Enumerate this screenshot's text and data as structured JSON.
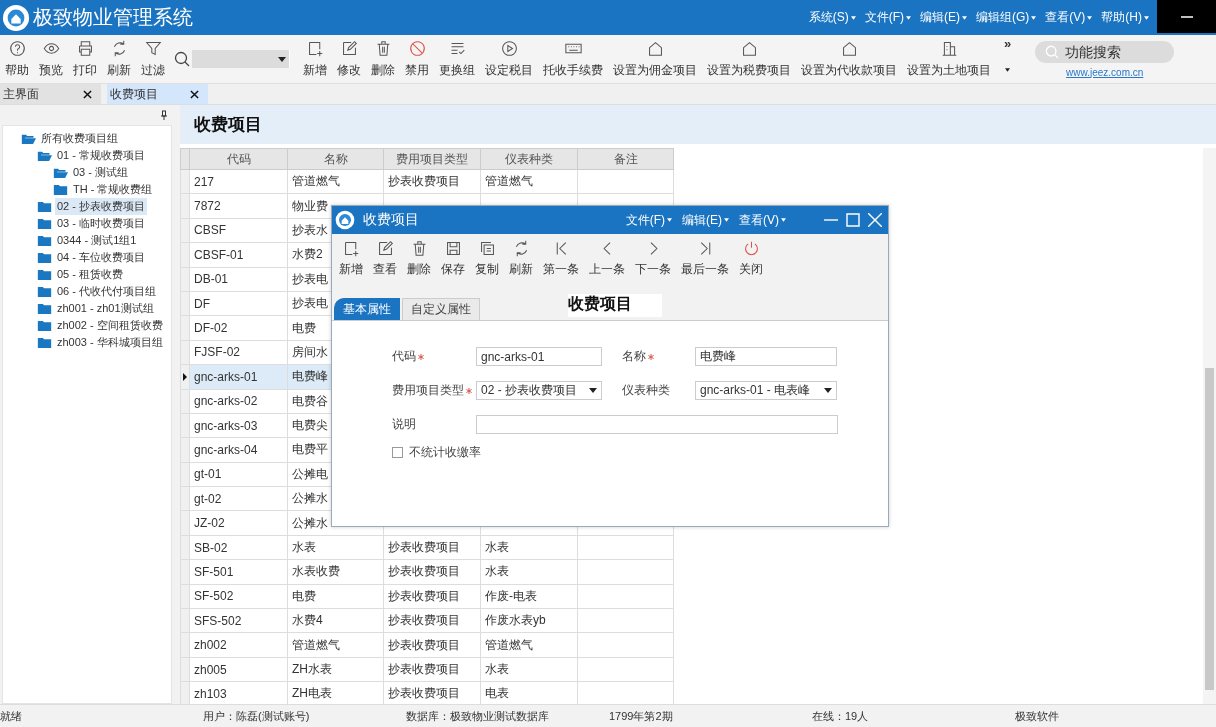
{
  "window": {
    "title": "极致物业管理系统",
    "menus": [
      {
        "label": "系统(S)"
      },
      {
        "label": "文件(F)"
      },
      {
        "label": "编辑(E)"
      },
      {
        "label": "编辑组(G)"
      },
      {
        "label": "查看(V)"
      },
      {
        "label": "帮助(H)"
      }
    ]
  },
  "toolbar": {
    "left": [
      {
        "label": "帮助"
      },
      {
        "label": "预览"
      },
      {
        "label": "打印"
      },
      {
        "label": "刷新"
      },
      {
        "label": "过滤"
      }
    ],
    "right": [
      {
        "label": "新增"
      },
      {
        "label": "修改"
      },
      {
        "label": "删除"
      },
      {
        "label": "禁用"
      },
      {
        "label": "更换组"
      },
      {
        "label": "设定税目"
      },
      {
        "label": "托收手续费"
      },
      {
        "label": "设置为佣金项目"
      },
      {
        "label": "设置为税费项目"
      },
      {
        "label": "设置为代收款项目"
      },
      {
        "label": "设置为土地项目"
      }
    ],
    "more": "»",
    "feature_search": {
      "placeholder": "功能搜索"
    },
    "link": "www.jeez.com.cn"
  },
  "tabs": [
    {
      "label": "主界面",
      "selected": false
    },
    {
      "label": "收费项目",
      "selected": true
    }
  ],
  "tree": [
    {
      "label": "所有收费项目组",
      "expanded": true,
      "selected": false,
      "children": [
        {
          "label": "01 - 常规收费项目",
          "expanded": true,
          "selected": false,
          "children": [
            {
              "label": "03 - 测试组",
              "expanded": true,
              "selected": false
            },
            {
              "label": "TH - 常规收费组",
              "expanded": false,
              "selected": false
            }
          ]
        },
        {
          "label": "02 - 抄表收费项目",
          "expanded": false,
          "selected": true
        },
        {
          "label": "03 - 临时收费项目",
          "expanded": false,
          "selected": false
        },
        {
          "label": "0344 - 测试1组1",
          "expanded": false,
          "selected": false
        },
        {
          "label": "04 - 车位收费项目",
          "expanded": false,
          "selected": false
        },
        {
          "label": "05 - 租赁收费",
          "expanded": false,
          "selected": false
        },
        {
          "label": "06 - 代收代付项目组",
          "expanded": false,
          "selected": false
        },
        {
          "label": "zh001 - zh01测试组",
          "expanded": false,
          "selected": false
        },
        {
          "label": "zh002 - 空间租赁收费",
          "expanded": false,
          "selected": false
        },
        {
          "label": "zh003 - 华科城项目组",
          "expanded": false,
          "selected": false
        }
      ]
    }
  ],
  "content": {
    "heading": "收费项目",
    "table": {
      "columns": [
        "代码",
        "名称",
        "费用项目类型",
        "仪表种类",
        "备注"
      ],
      "rows": [
        {
          "code": "217",
          "name": "管道燃气",
          "type": "抄表收费项目",
          "meter": "管道燃气",
          "selected": false
        },
        {
          "code": "7872",
          "name": "物业费",
          "selected": false
        },
        {
          "code": "CBSF",
          "name": "抄表水",
          "selected": false
        },
        {
          "code": "CBSF-01",
          "name": "水费2",
          "selected": false
        },
        {
          "code": "DB-01",
          "name": "抄表电",
          "selected": false
        },
        {
          "code": "DF",
          "name": "抄表电",
          "selected": false
        },
        {
          "code": "DF-02",
          "name": "电费",
          "selected": false
        },
        {
          "code": "FJSF-02",
          "name": "房间水",
          "selected": false
        },
        {
          "code": "gnc-arks-01",
          "name": "电费峰",
          "selected": true
        },
        {
          "code": "gnc-arks-02",
          "name": "电费谷",
          "selected": false
        },
        {
          "code": "gnc-arks-03",
          "name": "电费尖",
          "selected": false
        },
        {
          "code": "gnc-arks-04",
          "name": "电费平",
          "selected": false
        },
        {
          "code": "gt-01",
          "name": "公摊电",
          "selected": false
        },
        {
          "code": "gt-02",
          "name": "公摊水",
          "selected": false
        },
        {
          "code": "JZ-02",
          "name": "公摊水",
          "selected": false
        },
        {
          "code": "SB-02",
          "name": "水表",
          "type": "抄表收费项目",
          "meter": "水表",
          "selected": false
        },
        {
          "code": "SF-501",
          "name": "水表收费",
          "type": "抄表收费项目",
          "meter": "水表",
          "selected": false
        },
        {
          "code": "SF-502",
          "name": "电费",
          "type": "抄表收费项目",
          "meter": "作废-电表",
          "selected": false
        },
        {
          "code": "SFS-502",
          "name": "水费4",
          "type": "抄表收费项目",
          "meter": "作废水表yb",
          "selected": false
        },
        {
          "code": "zh002",
          "name": "管道燃气",
          "type": "抄表收费项目",
          "meter": "管道燃气",
          "selected": false
        },
        {
          "code": "zh005",
          "name": "ZH水表",
          "type": "抄表收费项目",
          "meter": "水表",
          "selected": false
        },
        {
          "code": "zh103",
          "name": "ZH电表",
          "type": "抄表收费项目",
          "meter": "电表",
          "selected": false
        }
      ]
    }
  },
  "dialog": {
    "title": "收费项目",
    "menus": [
      {
        "label": "文件(F)"
      },
      {
        "label": "编辑(E)"
      },
      {
        "label": "查看(V)"
      }
    ],
    "toolbar": [
      {
        "label": "新增"
      },
      {
        "label": "查看"
      },
      {
        "label": "删除"
      },
      {
        "label": "保存"
      },
      {
        "label": "复制"
      },
      {
        "label": "刷新"
      },
      {
        "label": "第一条"
      },
      {
        "label": "上一条"
      },
      {
        "label": "下一条"
      },
      {
        "label": "最后一条"
      },
      {
        "label": "关闭"
      }
    ],
    "tabs": [
      {
        "label": "基本属性",
        "selected": true
      },
      {
        "label": "自定义属性",
        "selected": false
      }
    ],
    "heading": "收费项目",
    "fields": [
      {
        "label": "代码",
        "required": true,
        "kind": "text",
        "value": "gnc-arks-01"
      },
      {
        "label": "名称",
        "required": true,
        "kind": "text",
        "value": "电费峰"
      },
      {
        "label": "费用项目类型",
        "required": true,
        "kind": "select",
        "value": "02 - 抄表收费项目"
      },
      {
        "label": "仪表种类",
        "kind": "select",
        "value": "gnc-arks-01  - 电表峰"
      },
      {
        "label": "说明",
        "kind": "wide"
      }
    ],
    "checkbox": {
      "label": "不统计收缴率",
      "checked": false
    }
  },
  "status_bar": [
    "就绪",
    "用户：陈磊(测试账号)",
    "数据库：极致物业测试数据库",
    "1799年第2期",
    "在线：19人",
    "极致软件"
  ]
}
